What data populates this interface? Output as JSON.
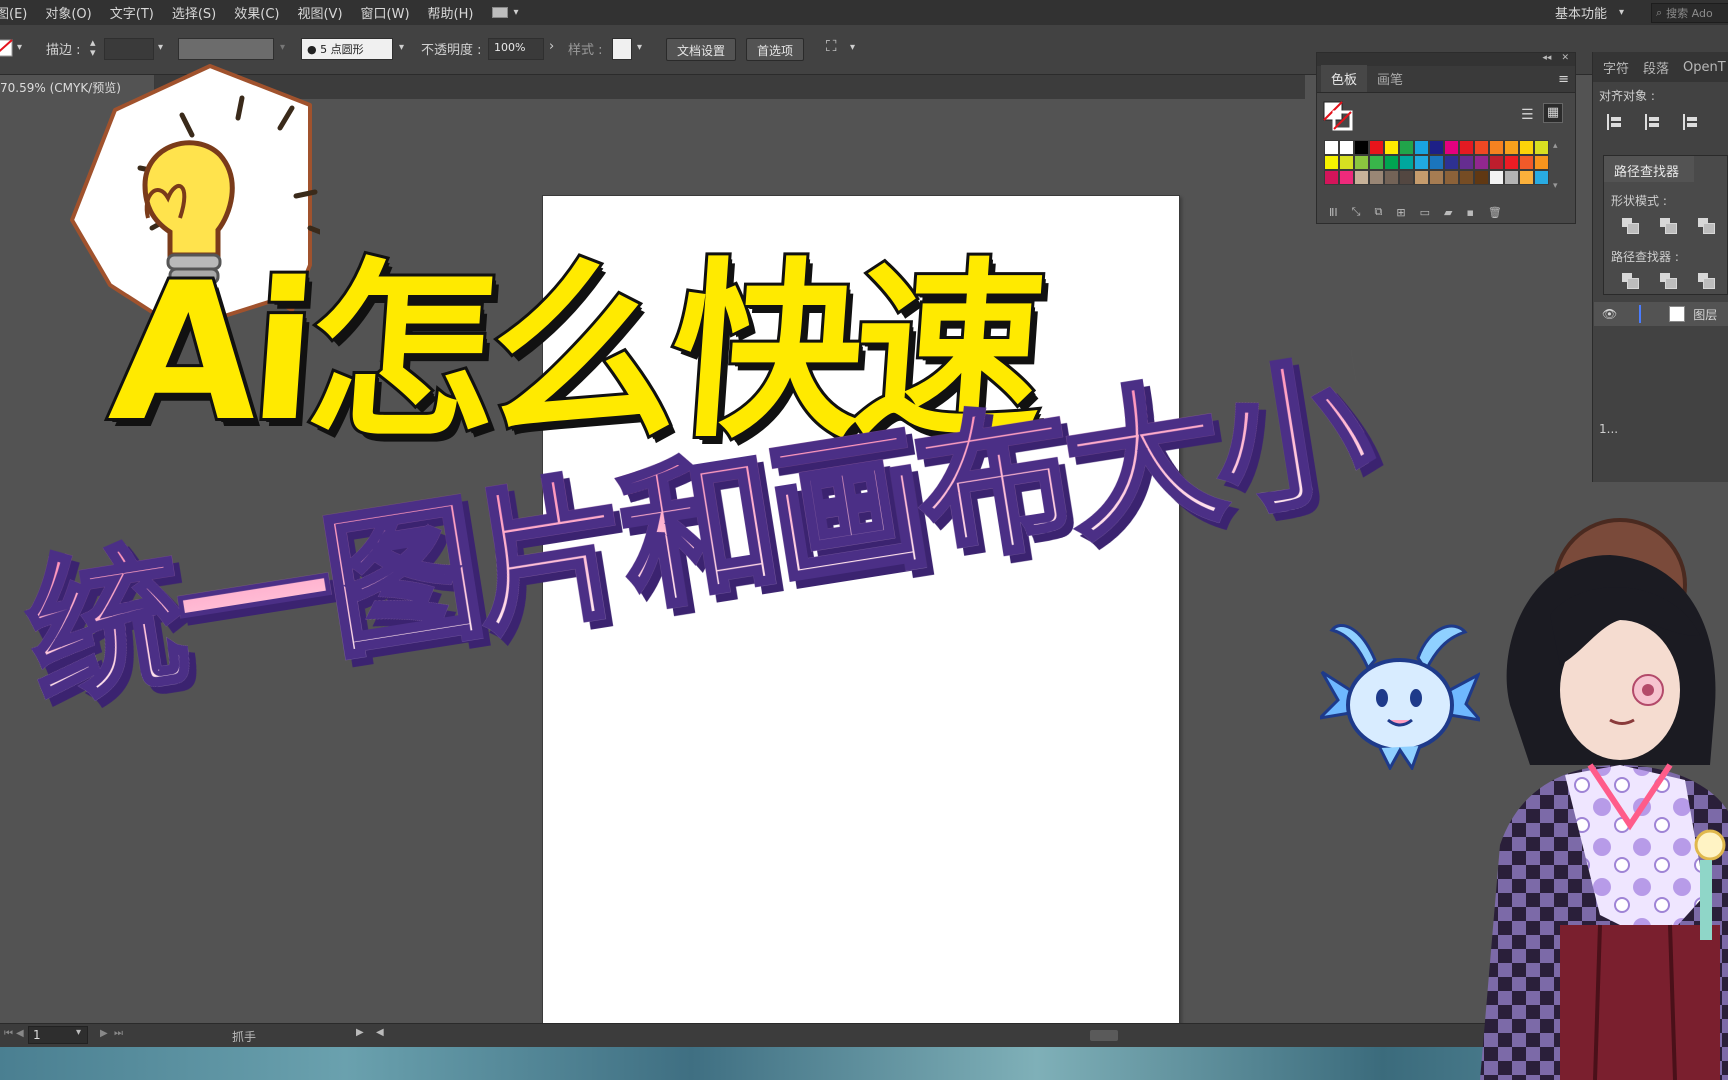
{
  "menu": {
    "items": [
      "图(E)",
      "对象(O)",
      "文字(T)",
      "选择(S)",
      "效果(C)",
      "视图(V)",
      "窗口(W)",
      "帮助(H)"
    ],
    "workspace": "基本功能",
    "search_placeholder": "搜索 Ado"
  },
  "control_bar": {
    "stroke_label": "描边 :",
    "brush_value": "5 点圆形",
    "opacity_label": "不透明度 :",
    "opacity_value": "100%",
    "style_label": "样式 :",
    "doc_setup_button": "文档设置",
    "preferences_button": "首选项"
  },
  "document": {
    "tab_label": "70.59% (CMYK/预览)"
  },
  "swatches_panel": {
    "tabs": [
      "色板",
      "画笔"
    ],
    "active_tab": "色板",
    "colors": [
      "#ffffff",
      "#ffffff",
      "#000000",
      "#e8141b",
      "#ffea00",
      "#21a44a",
      "#18a4e0",
      "#1d2087",
      "#e3007f",
      "#e41a22",
      "#ef4823",
      "#f58220",
      "#f7a01c",
      "#fcd309",
      "#d9e021",
      "#f6f200",
      "#d7e021",
      "#8cc63f",
      "#39b54a",
      "#00a551",
      "#00a79d",
      "#21a9e1",
      "#1b75bc",
      "#2e3192",
      "#652d90",
      "#92278f",
      "#be1e2d",
      "#ed1c24",
      "#f15a29",
      "#f7941d",
      "#d4145a",
      "#ee2a7b",
      "#c7b299",
      "#998675",
      "#736357",
      "#534741",
      "#c69c6d",
      "#a67c52",
      "#8c6239",
      "#754c24",
      "#603813",
      "#f2f2f2",
      "#b3b3b3",
      "#fbb03b",
      "#29abe2"
    ]
  },
  "right_dock": {
    "tabs": [
      "字符",
      "段落",
      "OpenT"
    ],
    "align_label": "对齐对象 :",
    "pathfinder_tab": "路径查找器",
    "shape_modes_label": "形状模式 :",
    "pathfinders_label": "路径查找器 :",
    "layer_name": "图层",
    "layers_count": "1..."
  },
  "status_bar": {
    "page_number": "1",
    "tool_name": "抓手"
  },
  "thumbnail": {
    "headline_line1": "Ai怎么快速",
    "headline_line2": "统一图片和画布大小"
  },
  "colors": {
    "menu_bg": "#323232",
    "canvas_bg": "#535353",
    "headline_yellow": "#ffea00",
    "headline_pink": "#ff8fb7",
    "headline_outline_purple": "#4b2f86"
  }
}
